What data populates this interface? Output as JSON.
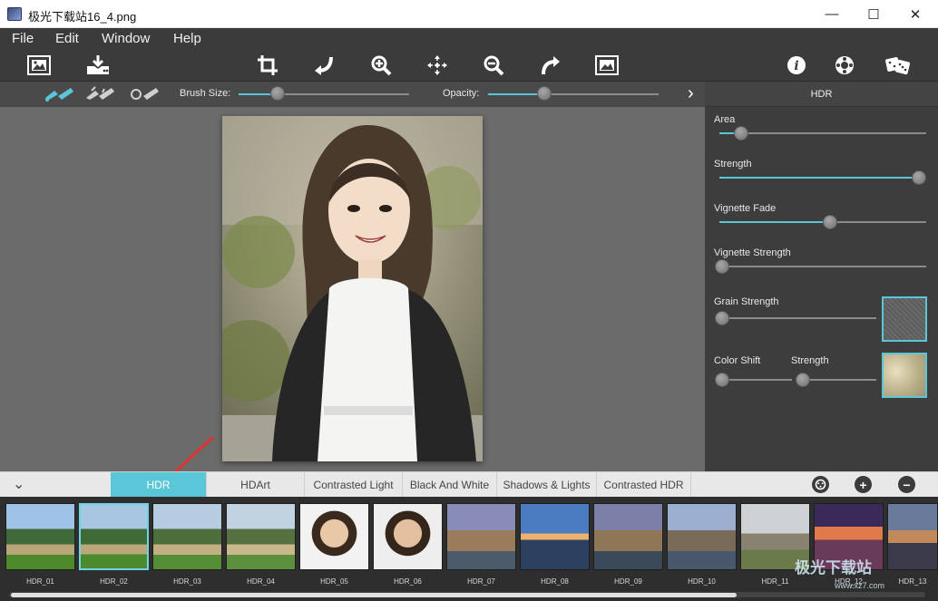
{
  "window": {
    "title": "极光下载站16_4.png",
    "minimize_glyph": "—",
    "maximize_glyph": "☐",
    "close_glyph": "✕"
  },
  "menu": {
    "items": [
      "File",
      "Edit",
      "Window",
      "Help"
    ]
  },
  "toolbar": {
    "tools": [
      "open-image",
      "save-download",
      "crop",
      "undo",
      "zoom-in",
      "move",
      "zoom-out",
      "redo",
      "fit-image",
      "info",
      "settings",
      "random-dice"
    ]
  },
  "brushbar": {
    "brush_size_label": "Brush Size:",
    "brush_size_value": 0.24,
    "opacity_label": "Opacity:",
    "opacity_value": 0.35,
    "next_glyph": "›"
  },
  "panel": {
    "title": "HDR",
    "params": [
      {
        "label": "Area",
        "value": 0.11
      },
      {
        "label": "Strength",
        "value": 1.0
      },
      {
        "label": "Vignette Fade",
        "value": 0.55
      },
      {
        "label": "Vignette Strength",
        "value": 0.0
      },
      {
        "label": "Grain Strength",
        "value": 0.0
      }
    ],
    "color_shift_label": "Color Shift",
    "color_shift_value": 0.0,
    "color_shift_strength_label": "Strength",
    "color_shift_strength_value": 0.0
  },
  "presets": {
    "collapse_glyph": "⌄",
    "tabs": [
      "HDR",
      "HDArt",
      "Contrasted Light",
      "Black And White",
      "Shadows & Lights",
      "Contrasted HDR"
    ],
    "active_tab": 0,
    "add_glyph": "+",
    "remove_glyph": "−",
    "thumbnails": [
      "HDR_01",
      "HDR_02",
      "HDR_03",
      "HDR_04",
      "HDR_05",
      "HDR_06",
      "HDR_07",
      "HDR_08",
      "HDR_09",
      "HDR_10",
      "HDR_11",
      "HDR_12",
      "HDR_13"
    ],
    "selected_thumbnail": 1
  },
  "watermark": {
    "text": "极光下载站",
    "url": "www.xz7.com"
  },
  "colors": {
    "accent": "#5cc6d9",
    "arrow": "#e23232"
  }
}
